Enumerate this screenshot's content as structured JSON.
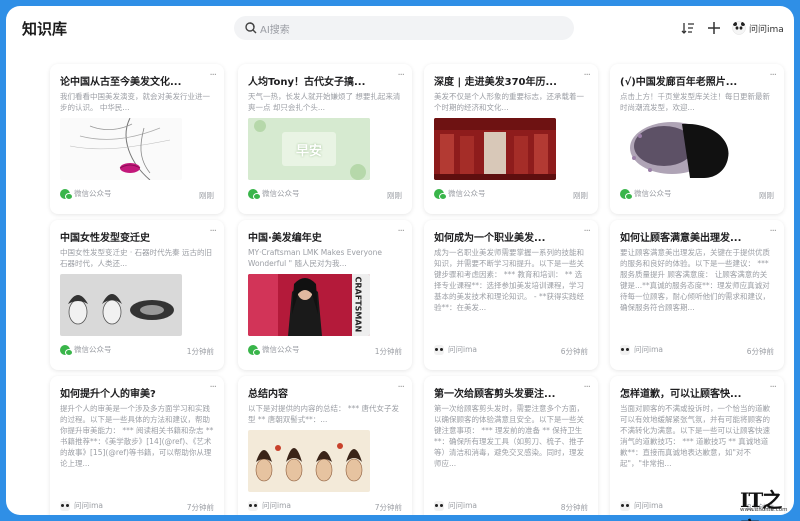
{
  "app": {
    "title": "知识库",
    "search_placeholder": "AI搜索",
    "user_name": "问问ima"
  },
  "accent": "#2f8fe6",
  "cards": [
    {
      "title": "论中国从古至今美发文化...",
      "desc": "我们看看中国美发演变，就会对美发行业进一步的认识。 中华民...",
      "source": "微信公众号",
      "source_icon": "wechat-icon",
      "time": "刚刚",
      "thumb": "face-sketch-icon"
    },
    {
      "title": "人均Tony！古代女子搞...",
      "desc": "天气一热，长发人就开始嫌烦了 想要扎起来清爽一点 却只会扎个头...",
      "source": "微信公众号",
      "source_icon": "wechat-icon",
      "time": "刚刚",
      "thumb": "zao-an-card",
      "thumb_text": "早安"
    },
    {
      "title": "深度 | 走进美发370年历...",
      "desc": "美发不仅是个人形象的重要标志，还承载着一个时期的经济和文化...",
      "source": "微信公众号",
      "source_icon": "wechat-icon",
      "time": "刚刚",
      "thumb": "red-hall-photo"
    },
    {
      "title": "(√)中国发廊百年老照片...",
      "desc": "点击上方！千页堂发型库关注！每日更新最新时尚潮流发型，欢迎...",
      "source": "微信公众号",
      "source_icon": "wechat-icon",
      "time": "刚刚",
      "thumb": "head-silhouette-icon"
    },
    {
      "title": "中国女性发型变迁史",
      "desc": "中国女性发型变迁史 · 石器时代先秦 远古的旧石器时代，人类还...",
      "source": "微信公众号",
      "source_icon": "wechat-icon",
      "time": "1分钟前",
      "thumb": "hairstyle-sketches"
    },
    {
      "title": "中国·美发编年史",
      "desc": "MY·Craftsman LMK Makes Everyone Wonderful \" 随人民对为我...",
      "source": "微信公众号",
      "source_icon": "wechat-icon",
      "time": "1分钟前",
      "thumb": "runway-photo",
      "thumb_text": "CRAFTSMAN"
    },
    {
      "title": "如何成为一个职业美发...",
      "desc": "成为一名职业美发师需要掌握一系列的技能和知识，并需要不断学习和提升。以下是一些关键步骤和考虑因素： *** 教育和培训： ** 选择专业课程**：选择参加美发培训课程，学习基本的美发技术和理论知识。 - **获得实践经验**：在美发...",
      "source": "问问ima",
      "source_icon": "ima-icon",
      "time": "6分钟前",
      "thumb": ""
    },
    {
      "title": "如何让顾客满意美出理发...",
      "desc": "要让顾客满意美出理发店，关键在于提供优质的服务和良好的体验。以下是一些建议： *** 服务质量提升 顾客满意度： 让顾客满意的关键是...**真诚的服务态度**：理发师应真诚对待每一位顾客，耐心倾听他们的需求和建议，确保服务符合顾客期...",
      "source": "问问ima",
      "source_icon": "ima-icon",
      "time": "6分钟前",
      "thumb": ""
    },
    {
      "title": "如何提升个人的审美?",
      "desc": "提升个人的审美是一个涉及多方面学习和实践的过程。以下是一些具体的方法和建议，帮助你提升审美能力： *** 阅读相关书籍和杂志 ** 书籍推荐**：《美学散步》[14](@ref)、《艺术的故事》[15](@ref)等书籍，可以帮助你从理论上理...",
      "source": "问问ima",
      "source_icon": "ima-icon",
      "time": "7分钟前",
      "thumb": ""
    },
    {
      "title": "总结内容",
      "desc": "以下是对提供的内容的总结： *** 唐代女子发型 ** 唐朝双髻式**：...",
      "source": "问问ima",
      "source_icon": "ima-icon",
      "time": "7分钟前",
      "thumb": "tang-hairstyles"
    },
    {
      "title": "第一次给顾客剪头发要注...",
      "desc": "第一次给顾客剪头发时，需要注意多个方面，以确保顾客的体验满意且安全。以下是一些关键注意事项： *** 理发前的准备 ** 保持卫生**：确保所有理发工具（如剪刀、梳子、推子等）清洁和消毒，避免交叉感染。同时，理发师应...",
      "source": "问问ima",
      "source_icon": "ima-icon",
      "time": "8分钟前",
      "thumb": ""
    },
    {
      "title": "怎样道歉，可以让顾客快...",
      "desc": "当面对顾客的不满或投诉时，一个恰当的道歉可以有效地缓解紧张气氛，并有可能将顾客的不满转化为满意。以下是一些可以让顾客快速消气的道歉技巧： *** 道歉技巧 ** 真诚地道歉**：直接而真诚地表达歉意，如\"对不起\"，\"非常抱...",
      "source": "问问ima",
      "source_icon": "ima-icon",
      "time": "8分钟前",
      "thumb": ""
    }
  ],
  "watermark": {
    "logo": "IT之家",
    "url": "www.ithome.com"
  }
}
